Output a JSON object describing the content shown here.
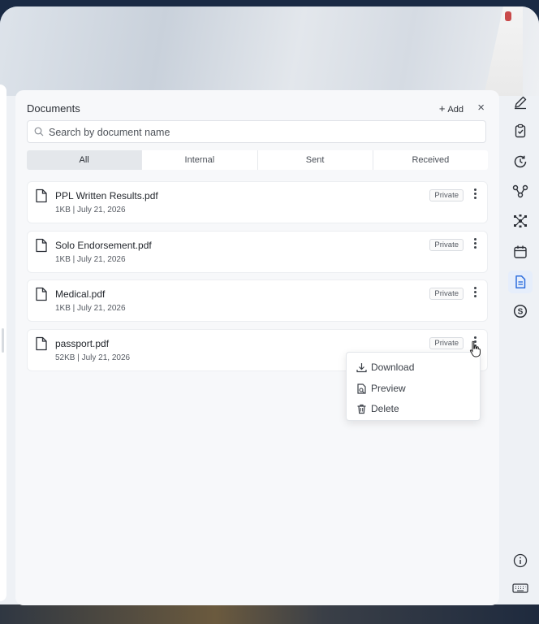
{
  "panel": {
    "title": "Documents",
    "add_label": "Add",
    "close_label": "×"
  },
  "search": {
    "placeholder": "Search by document name",
    "value": ""
  },
  "tabs": [
    {
      "label": "All",
      "selected": true
    },
    {
      "label": "Internal",
      "selected": false
    },
    {
      "label": "Sent",
      "selected": false
    },
    {
      "label": "Received",
      "selected": false
    }
  ],
  "documents": [
    {
      "name": "PPL Written Results.pdf",
      "meta": "1KB | July 21, 2026",
      "badge": "Private"
    },
    {
      "name": "Solo Endorsement.pdf",
      "meta": "1KB | July 21, 2026",
      "badge": "Private"
    },
    {
      "name": "Medical.pdf",
      "meta": "1KB | July 21, 2026",
      "badge": "Private"
    },
    {
      "name": "passport.pdf",
      "meta": "52KB | July 21, 2026",
      "badge": "Private"
    }
  ],
  "context_menu": {
    "items": [
      {
        "label": "Download",
        "icon": "download-icon"
      },
      {
        "label": "Preview",
        "icon": "preview-icon"
      },
      {
        "label": "Delete",
        "icon": "trash-icon"
      }
    ]
  },
  "rail": {
    "icons": [
      "pen-icon",
      "clipboard-check-icon",
      "history-icon",
      "route-icon",
      "network-icon",
      "calendar-icon",
      "document-icon",
      "dollar-icon",
      "info-icon",
      "keyboard-icon"
    ],
    "active": "document-icon"
  },
  "colors": {
    "accent": "#2f6fde",
    "panel_bg": "#f7f8fa"
  }
}
